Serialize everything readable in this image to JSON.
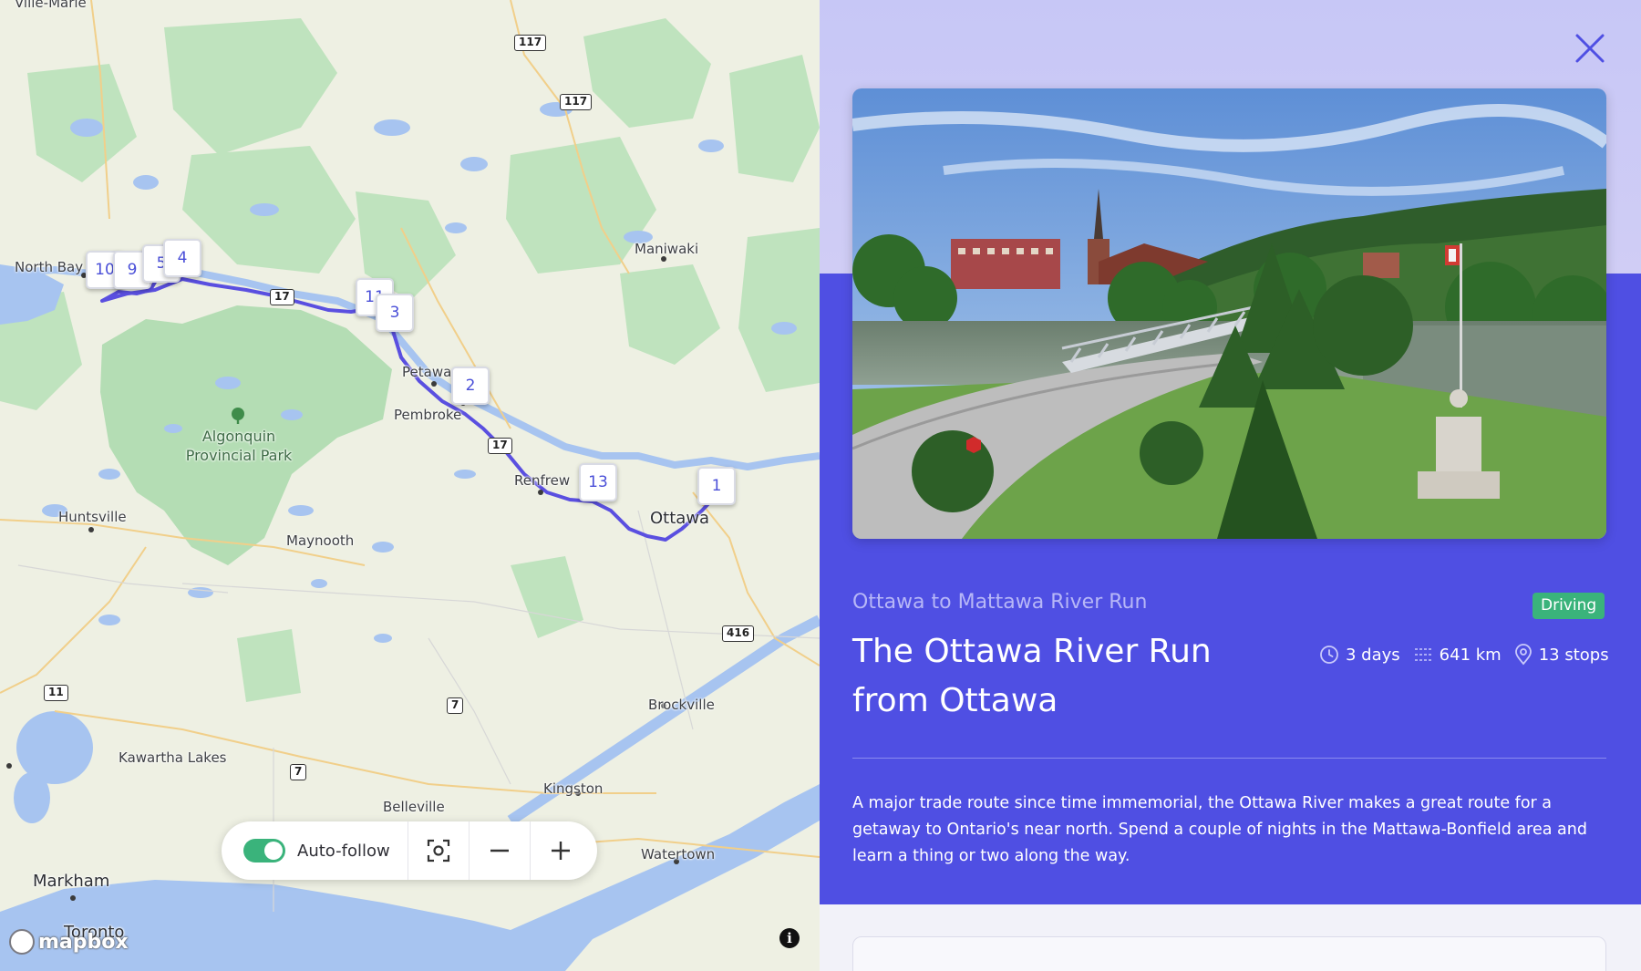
{
  "map": {
    "places": {
      "ville_marie": "Ville-Marie",
      "north_bay": "North Bay",
      "maniwaki": "Maniwaki",
      "petawawa": "Petawawa",
      "pembroke": "Pembroke",
      "algonquin_line1": "Algonquin",
      "algonquin_line2": "Provincial Park",
      "renfrew": "Renfrew",
      "huntsville": "Huntsville",
      "maynooth": "Maynooth",
      "ottawa": "Ottawa",
      "brockville": "Brockville",
      "kawartha": "Kawartha Lakes",
      "kingston": "Kingston",
      "belleville": "Belleville",
      "watertown": "Watertown",
      "markham": "Markham",
      "toronto": "Toronto"
    },
    "highways": [
      "117",
      "117",
      "17",
      "17",
      "416",
      "11",
      "7",
      "7"
    ],
    "markers": [
      "10",
      "9",
      "5",
      "4",
      "11",
      "3",
      "2",
      "13",
      "1"
    ],
    "route_color": "#5a4fe0",
    "controls": {
      "auto_follow_label": "Auto-follow",
      "auto_follow_on": true
    },
    "attribution": "mapbox",
    "info_label": "i"
  },
  "panel": {
    "subtitle": "Ottawa to Mattawa River Run",
    "mode_badge": "Driving",
    "title": "The Ottawa River Run from Ottawa",
    "stats": {
      "duration": "3 days",
      "distance": "641 km",
      "stops": "13 stops"
    },
    "description": "A major trade route since time immemorial, the Ottawa River makes a great route for a getaway to Ontario's near north. Spend a couple of nights in the Mattawa-Bonfield area and learn a thing or two along the way.",
    "colors": {
      "band": "#4f4fe3",
      "badge": "#3ab37b",
      "top_gradient": "#c7c7f6"
    }
  }
}
